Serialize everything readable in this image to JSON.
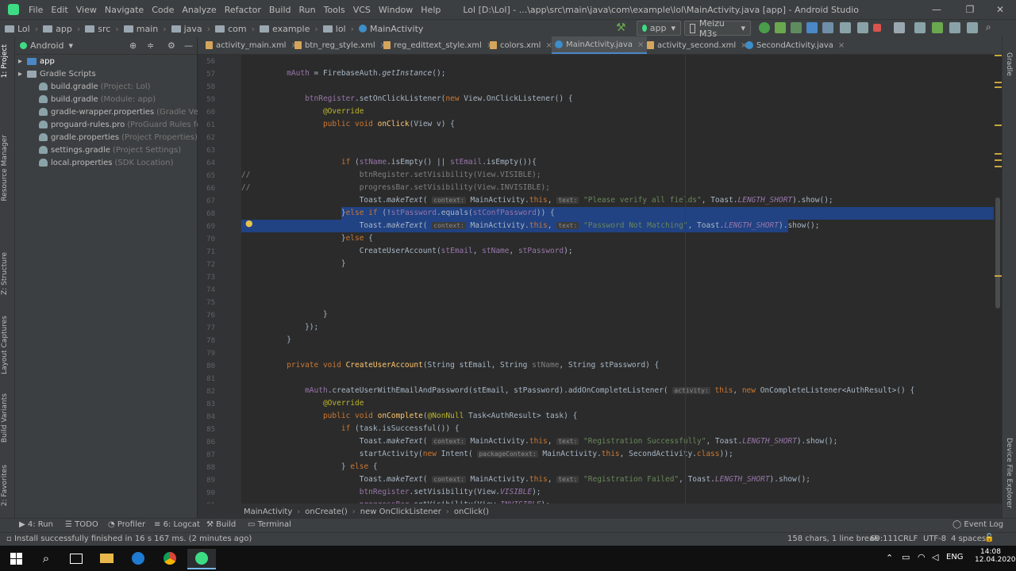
{
  "menu": [
    "File",
    "Edit",
    "View",
    "Navigate",
    "Code",
    "Analyze",
    "Refactor",
    "Build",
    "Run",
    "Tools",
    "VCS",
    "Window",
    "Help"
  ],
  "window_title": "Lol [D:\\Lol] - ...\\app\\src\\main\\java\\com\\example\\lol\\MainActivity.java [app] - Android Studio",
  "window_controls": [
    "—",
    "❐",
    "✕"
  ],
  "breadcrumb": [
    "Lol",
    "app",
    "src",
    "main",
    "java",
    "com",
    "example",
    "lol",
    "MainActivity"
  ],
  "run_config": "app",
  "device": "Meizu M3s",
  "project": {
    "view_mode": "Android",
    "tree": [
      {
        "label": "app",
        "hint": ""
      },
      {
        "label": "Gradle Scripts",
        "hint": ""
      },
      {
        "label": "build.gradle",
        "hint": "(Project: Lol)"
      },
      {
        "label": "build.gradle",
        "hint": "(Module: app)"
      },
      {
        "label": "gradle-wrapper.properties",
        "hint": "(Gradle Version)"
      },
      {
        "label": "proguard-rules.pro",
        "hint": "(ProGuard Rules for app)"
      },
      {
        "label": "gradle.properties",
        "hint": "(Project Properties)"
      },
      {
        "label": "settings.gradle",
        "hint": "(Project Settings)"
      },
      {
        "label": "local.properties",
        "hint": "(SDK Location)"
      }
    ]
  },
  "tabs": [
    "activity_main.xml",
    "btn_reg_style.xml",
    "reg_edittext_style.xml",
    "colors.xml",
    "MainActivity.java",
    "activity_second.xml",
    "SecondActivity.java"
  ],
  "active_tab": "MainActivity.java",
  "line_numbers": [
    "56",
    "57",
    "58",
    "59",
    "60",
    "61",
    "62",
    "63",
    "64",
    "65",
    "66",
    "67",
    "68",
    "69",
    "70",
    "71",
    "72",
    "73",
    "74",
    "75",
    "76",
    "77",
    "78",
    "79",
    "80",
    "81",
    "82",
    "83",
    "84",
    "85",
    "86",
    "87",
    "88",
    "89",
    "90",
    "91"
  ],
  "left_stripe": [
    "1: Project",
    "Resource Manager",
    "Z: Structure",
    "Layout Captures",
    "Build Variants",
    "2: Favorites"
  ],
  "right_stripe": [
    "Gradle",
    "Device File Explorer"
  ],
  "editor_breadcrumb": [
    "MainActivity",
    "onCreate()",
    "new OnClickListener",
    "onClick()"
  ],
  "tool_windows": [
    "4: Run",
    "TODO",
    "Profiler",
    "6: Logcat",
    "Build",
    "Terminal"
  ],
  "event_log": "Event Log",
  "status": {
    "message": "Install successfully finished in 16 s 167 ms. (2 minutes ago)",
    "selection": "158 chars, 1 line break",
    "position": "69:111",
    "line_sep": "CRLF",
    "encoding": "UTF-8",
    "indent": "4 spaces"
  },
  "taskbar": {
    "lang": "ENG",
    "time": "14:08",
    "date": "12.04.2020"
  },
  "colors": {
    "accent": "#4a88c7",
    "selection": "#214283",
    "keyword": "#cc7832",
    "string": "#6a8759",
    "method": "#ffc66d",
    "field": "#9876aa"
  }
}
